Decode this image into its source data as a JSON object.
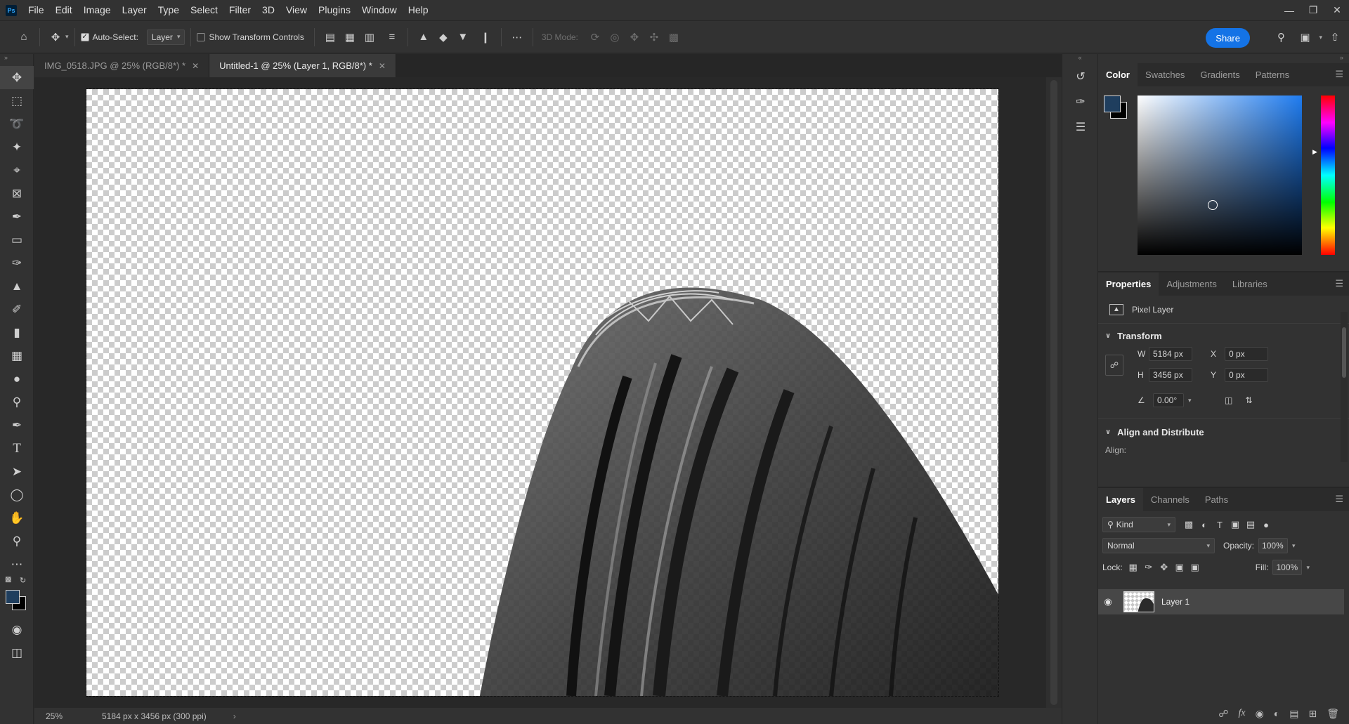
{
  "app": {
    "logo": "Ps"
  },
  "menubar": {
    "items": [
      "File",
      "Edit",
      "Image",
      "Layer",
      "Type",
      "Select",
      "Filter",
      "3D",
      "View",
      "Plugins",
      "Window",
      "Help"
    ],
    "window_controls": [
      "minimize-icon",
      "restore-icon",
      "close-icon"
    ]
  },
  "options": {
    "auto_select_label": "Auto-Select:",
    "auto_select_checked": true,
    "auto_select_target": "Layer",
    "show_transform_label": "Show Transform Controls",
    "show_transform_checked": false,
    "three_d_mode_label": "3D Mode:",
    "share_label": "Share"
  },
  "tools": [
    "move-tool",
    "rectangular-marquee-tool",
    "lasso-tool",
    "magic-wand-tool",
    "crop-tool",
    "frame-tool",
    "eyedropper-tool",
    "healing-brush-tool",
    "brush-tool",
    "clone-stamp-tool",
    "history-brush-tool",
    "eraser-tool",
    "gradient-tool",
    "blur-tool",
    "dodge-tool",
    "pen-tool",
    "type-tool",
    "path-selection-tool",
    "ellipse-tool",
    "hand-tool",
    "zoom-tool",
    "edit-toolbar"
  ],
  "colors": {
    "foreground": "#1f3e5e",
    "background": "#000000",
    "accent": "#1473e6"
  },
  "doc_tabs": [
    {
      "title": "IMG_0518.JPG @ 25% (RGB/8*) *",
      "active": false
    },
    {
      "title": "Untitled-1 @ 25% (Layer 1, RGB/8*) *",
      "active": true
    }
  ],
  "status": {
    "zoom": "25%",
    "doc_info": "5184 px x 3456 px (300 ppi)"
  },
  "color_panel": {
    "tabs": [
      "Color",
      "Swatches",
      "Gradients",
      "Patterns"
    ],
    "active": "Color"
  },
  "properties_panel": {
    "tabs": [
      "Properties",
      "Adjustments",
      "Libraries"
    ],
    "active": "Properties",
    "layer_type": "Pixel Layer",
    "transform_heading": "Transform",
    "w_label": "W",
    "w_value": "5184 px",
    "h_label": "H",
    "h_value": "3456 px",
    "x_label": "X",
    "x_value": "0 px",
    "y_label": "Y",
    "y_value": "0 px",
    "angle_value": "0.00°",
    "align_heading": "Align and Distribute",
    "align_label": "Align:"
  },
  "layers_panel": {
    "tabs": [
      "Layers",
      "Channels",
      "Paths"
    ],
    "active": "Layers",
    "filter_kind": "Kind",
    "blend_mode": "Normal",
    "opacity_label": "Opacity:",
    "opacity_value": "100%",
    "lock_label": "Lock:",
    "fill_label": "Fill:",
    "fill_value": "100%",
    "layers": [
      {
        "name": "Layer 1",
        "visible": true,
        "selected": true
      }
    ]
  }
}
